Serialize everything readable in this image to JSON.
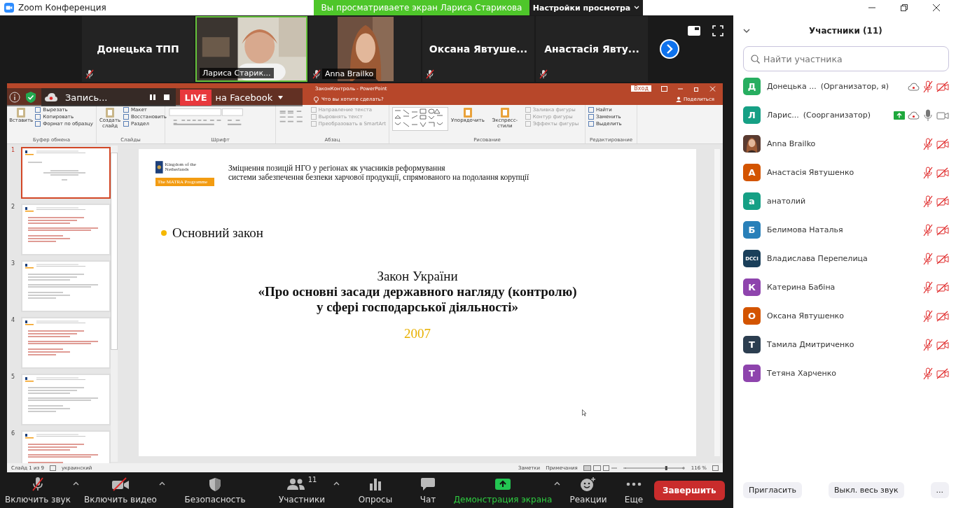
{
  "window": {
    "title": "Zoom Конференция"
  },
  "share_banner": {
    "text": "Вы просматриваете экран Лариса Старикова",
    "settings": "Настройки просмотра"
  },
  "video_tiles": [
    {
      "kind": "name",
      "name": "Донецька ТПП",
      "muted": true,
      "speaking": false
    },
    {
      "kind": "video",
      "name": "Лариса Старик...",
      "muted": false,
      "speaking": true
    },
    {
      "name": "Anna Brailko",
      "muted": true,
      "speaking": false
    },
    {
      "kind": "name",
      "name": "Оксана  Явтуше...",
      "muted": true,
      "speaking": false
    },
    {
      "kind": "name",
      "name": "Анастасія Явту...",
      "muted": true,
      "speaking": false
    }
  ],
  "recording_bar": {
    "label": "Запись...",
    "live": "LIVE",
    "destination": "на Facebook"
  },
  "powerpoint": {
    "title": "ЗаконКонтроль - PowerPoint",
    "tell_me": "Что вы хотите сделать?",
    "sign_in": "Вход",
    "share": "Поделиться",
    "ribbon_groups": [
      {
        "label": "Буфер обмена",
        "large": [
          "Вставить"
        ],
        "small": [
          "Вырезать",
          "Копировать",
          "Формат по образцу"
        ]
      },
      {
        "label": "Слайды",
        "large": [
          "Создать слайд"
        ],
        "small": [
          "Макет",
          "Восстановить",
          "Раздел"
        ]
      },
      {
        "label": "Шрифт"
      },
      {
        "label": "Абзац",
        "small": [
          "Направление текста",
          "Выровнять текст",
          "Преобразовать в SmartArt"
        ]
      },
      {
        "label": "Рисование",
        "large": [
          "Упорядочить",
          "Экспресс-стили"
        ],
        "small": [
          "Заливка фигуры",
          "Контур фигуры",
          "Эффекты фигуры"
        ]
      },
      {
        "label": "Редактирование",
        "small": [
          "Найти",
          "Заменить",
          "Выделить"
        ]
      }
    ],
    "thumbnails": [
      {
        "number": "1",
        "selected": true
      },
      {
        "number": "2",
        "selected": false
      },
      {
        "number": "3",
        "selected": false
      },
      {
        "number": "4",
        "selected": false
      },
      {
        "number": "5",
        "selected": false
      },
      {
        "number": "6",
        "selected": false
      }
    ],
    "slide": {
      "logo_caption": "Kingdom of the Netherlands",
      "logo_band": "The MATRA Programme",
      "header_lines": [
        "Зміцнення позицій НГО у регіонах як учасників реформування",
        "системи забезпечення безпеки харчової продукції, спрямованого на подолання корупції"
      ],
      "bullet": "Основний закон",
      "law_title": "Закон України",
      "law_name": [
        "«Про основні засади державного нагляду (контролю)",
        "у сфері господарської діяльності»"
      ],
      "year": "2007"
    },
    "status": {
      "slide": "Слайд 1 из 9",
      "language": "украинский",
      "notes": "Заметки",
      "comments": "Примечания",
      "zoom": "116 %",
      "zoom_slider": {
        "level": 0.7
      }
    }
  },
  "toolbar": [
    {
      "kind": "mic",
      "label": "Включить звук",
      "caret": true
    },
    {
      "kind": "video",
      "label": "Включить видео",
      "caret": true
    },
    {
      "kind": "security",
      "label": "Безопасность",
      "caret": false
    },
    {
      "kind": "participants",
      "label": "Участники",
      "count": "11",
      "caret": true
    },
    {
      "kind": "polls",
      "label": "Опросы",
      "caret": false
    },
    {
      "kind": "chat",
      "label": "Чат",
      "caret": false
    },
    {
      "kind": "share",
      "label": "Демонстрация экрана",
      "caret": true
    },
    {
      "kind": "reactions",
      "label": "Реакции",
      "caret": false
    },
    {
      "kind": "more",
      "label": "Еще",
      "caret": false
    }
  ],
  "end_button": "Завершить",
  "participants_panel": {
    "title": "Участники (11)",
    "search": {
      "placeholder": "Найти участника"
    },
    "participants": [
      {
        "avatar": "Д",
        "kind": "letter",
        "color": "#27ae60",
        "name": "Донецька ...",
        "role": "(Организатор, я)",
        "sharing": false,
        "recording": true,
        "mic_muted": true,
        "video_off": true
      },
      {
        "avatar": "Л",
        "kind": "letter",
        "color": "#16a085",
        "name": "Ларис...",
        "role": "(Соорганизатор)",
        "sharing": true,
        "recording": true,
        "mic_muted": false,
        "video_off": false
      },
      {
        "name": "Anna Brailko",
        "sharing": false,
        "recording": false,
        "mic_muted": true,
        "video_off": true
      },
      {
        "avatar": "А",
        "kind": "letter",
        "color": "#d35400",
        "name": "Анастасія Явтушенко",
        "sharing": false,
        "recording": false,
        "mic_muted": true,
        "video_off": true
      },
      {
        "avatar": "а",
        "kind": "letter",
        "color": "#16a085",
        "name": "анатолий",
        "sharing": false,
        "recording": false,
        "mic_muted": true,
        "video_off": true
      },
      {
        "avatar": "Б",
        "kind": "letter",
        "color": "#2980b9",
        "name": "Белимова Наталья",
        "sharing": false,
        "recording": false,
        "mic_muted": true,
        "video_off": true
      },
      {
        "avatar": "DCCI",
        "kind": "logo",
        "name": "Владислава Перепелица",
        "sharing": false,
        "recording": false,
        "mic_muted": true,
        "video_off": true
      },
      {
        "avatar": "К",
        "kind": "letter",
        "color": "#8e44ad",
        "name": "Катерина Бабіна",
        "sharing": false,
        "recording": false,
        "mic_muted": true,
        "video_off": true
      },
      {
        "avatar": "О",
        "kind": "letter",
        "color": "#d35400",
        "name": "Оксана Явтушенко",
        "sharing": false,
        "recording": false,
        "mic_muted": true,
        "video_off": true
      },
      {
        "avatar": "Т",
        "kind": "letter",
        "color": "#2c3e50",
        "name": "Тамила Дмитриченко",
        "sharing": false,
        "recording": false,
        "mic_muted": true,
        "video_off": true
      },
      {
        "avatar": "Т",
        "kind": "letter",
        "color": "#8e44ad",
        "name": "Тетяна Харченко",
        "sharing": false,
        "recording": false,
        "mic_muted": true,
        "video_off": true
      }
    ],
    "buttons": [
      "Пригласить",
      "Выкл. весь звук",
      "..."
    ]
  }
}
